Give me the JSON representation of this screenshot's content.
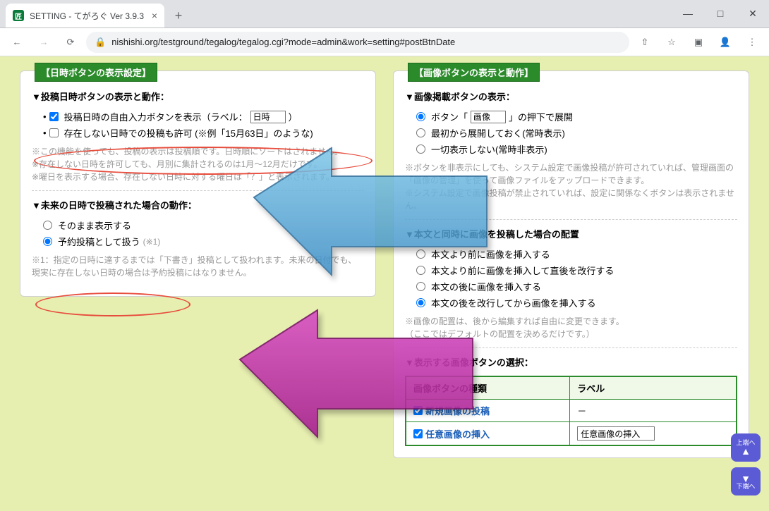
{
  "browser": {
    "tab_title": "SETTING - てがろぐ Ver 3.9.3",
    "url": "nishishi.org/testground/tegalog/tegalog.cgi?mode=admin&work=setting#postBtnDate"
  },
  "left_panel": {
    "title": "【日時ボタンの表示設定】",
    "sec1_head": "▼投稿日時ボタンの表示と動作：",
    "chk1_label_pre": "投稿日時の自由入力ボタンを表示（ラベル：",
    "chk1_input": "日時",
    "chk1_label_post": "）",
    "chk2_label": "存在しない日時での投稿も許可 (※例「15月63日」のような)",
    "note1": "※この機能を使っても、投稿の表示は投稿順です。日時順にソートはされません。\n※存在しない日時を許可しても、月別に集計されるのは1月～12月だけです。\n※曜日を表示する場合、存在しない日時に対する曜日は「？」と表示されます。",
    "sec2_head": "▼未来の日時で投稿された場合の動作：",
    "radio1_label": "そのまま表示する",
    "radio2_label": "予約投稿として扱う",
    "radio2_suffix": " (※1)",
    "note2": "※1：指定の日時に達するまでは「下書き」投稿として扱われます。未来の日付でも、現実に存在しない日時の場合は予約投稿にはなりません。"
  },
  "right_panel": {
    "title": "【画像ボタンの表示と動作】",
    "sec1_head": "▼画像掲載ボタンの表示：",
    "r1_pre": "ボタン「",
    "r1_input": "画像",
    "r1_post": "」の押下で展開",
    "r2_label": "最初から展開しておく(常時表示)",
    "r3_label": "一切表示しない(常時非表示)",
    "note1": "※ボタンを非表示にしても、システム設定で画像投稿が許可されていれば、管理画面の「画像の管理」を使って画像ファイルをアップロードできます。\n※システム設定で画像投稿が禁止されていれば、設定に関係なくボタンは表示されません。",
    "sec2_head": "▼本文と同時に画像を投稿した場合の配置",
    "p1": "本文より前に画像を挿入する",
    "p2": "本文より前に画像を挿入して直後を改行する",
    "p3": "本文の後に画像を挿入する",
    "p4": "本文の後を改行してから画像を挿入する",
    "note2": "※画像の配置は、後から編集すれば自由に変更できます。\n（ここではデフォルトの配置を決めるだけです。）",
    "sec3_head": "▼表示する画像ボタンの選択：",
    "th1": "画像ボタンの種類",
    "th2": "ラベル",
    "row1_name": "新規画像の投稿",
    "row1_label": "－",
    "row2_name": "任意画像の挿入",
    "row2_input": "任意画像の挿入"
  },
  "badges": {
    "up": "上端へ",
    "down": "下端へ"
  }
}
